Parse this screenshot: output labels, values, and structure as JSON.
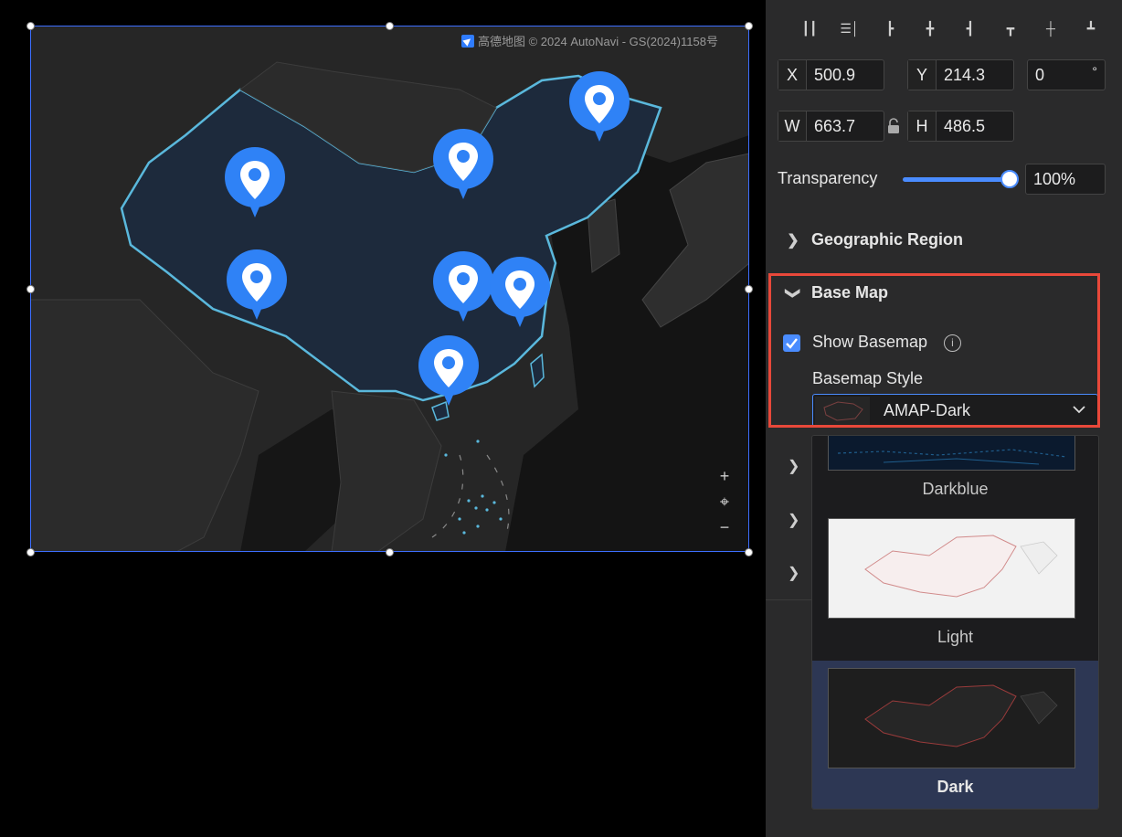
{
  "map": {
    "attribution": "高德地图 © 2024 AutoNavi - GS(2024)1158号",
    "controls": {
      "zoom_in": "+",
      "locate": "⌖",
      "zoom_out": "−"
    },
    "pin_count": 7,
    "colors": {
      "land": "#2b2b2b",
      "region_fill": "#1d2a3c",
      "border_glow": "#5ab8dc",
      "pin": "#2f82f6",
      "selection": "#3d6fff"
    }
  },
  "panel": {
    "align_icons": [
      "align-left-edge-icon",
      "align-center-v-icon",
      "align-left-icon",
      "align-h-center-icon",
      "align-right-icon",
      "align-top-icon",
      "align-v-middle-icon",
      "align-bottom-icon"
    ],
    "x": {
      "label": "X",
      "value": "500.9"
    },
    "y": {
      "label": "Y",
      "value": "214.3"
    },
    "rotation": {
      "value": "0",
      "unit": "°"
    },
    "w": {
      "label": "W",
      "value": "663.7"
    },
    "h": {
      "label": "H",
      "value": "486.5"
    },
    "transparency": {
      "label": "Transparency",
      "value": "100%",
      "level": 1.0
    },
    "sections": {
      "geographic_region": "Geographic Region",
      "base_map": "Base Map"
    },
    "show_basemap": {
      "label": "Show Basemap",
      "checked": true
    },
    "basemap_style": {
      "label": "Basemap Style",
      "selected": "AMAP-Dark"
    },
    "style_options": [
      {
        "label": "Darkblue"
      },
      {
        "label": "Light"
      },
      {
        "label": "Dark",
        "selected": true
      }
    ]
  }
}
